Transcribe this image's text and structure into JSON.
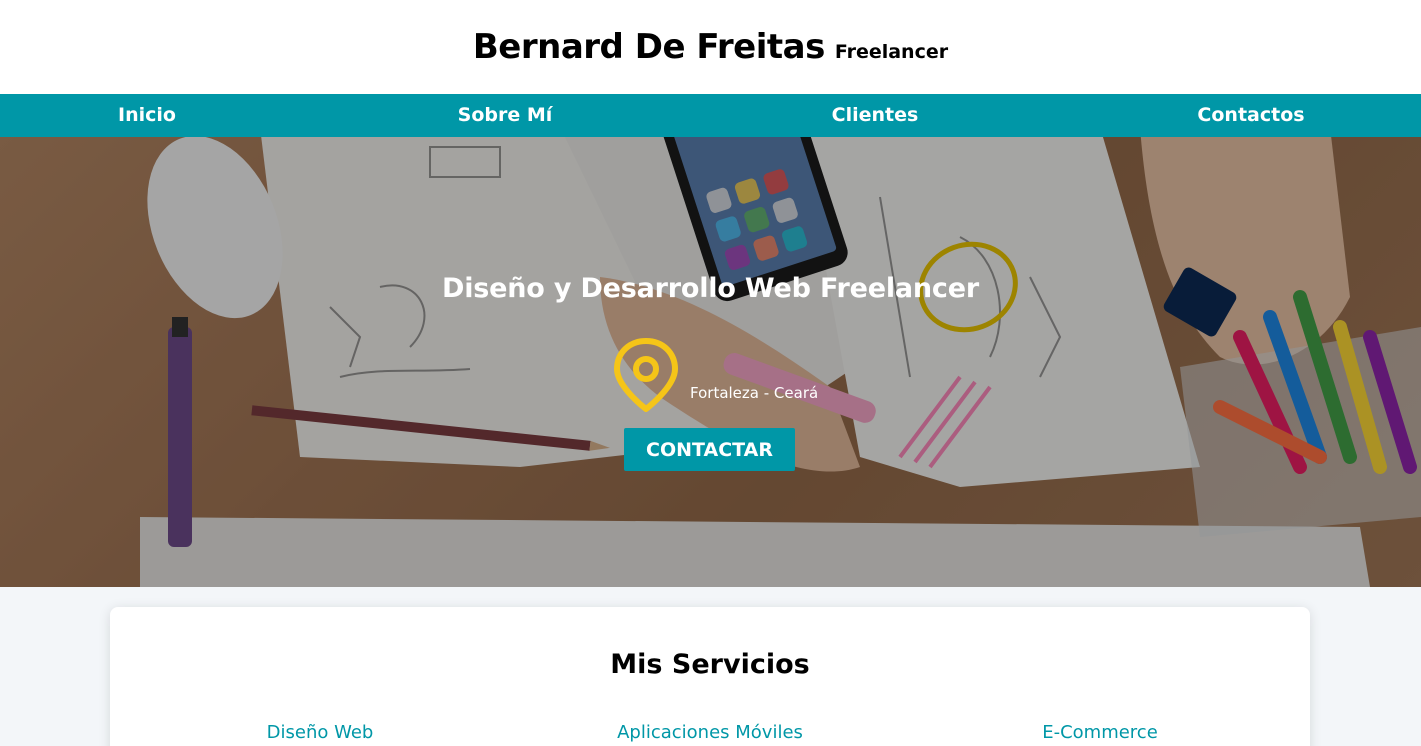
{
  "header": {
    "name": "Bernard De Freitas",
    "tagline": "Freelancer"
  },
  "nav": {
    "items": [
      {
        "label": "Inicio"
      },
      {
        "label": "Sobre Mí"
      },
      {
        "label": "Clientes"
      },
      {
        "label": "Contactos"
      }
    ]
  },
  "hero": {
    "title": "Diseño y Desarrollo Web Freelancer",
    "location": "Fortaleza - Ceará",
    "location_icon": "map-pin-icon",
    "cta_label": "CONTACTAR"
  },
  "services": {
    "title": "Mis Servicios",
    "items": [
      {
        "label": "Diseño Web"
      },
      {
        "label": "Aplicaciones Móviles"
      },
      {
        "label": "E-Commerce"
      }
    ]
  },
  "colors": {
    "accent": "#0097a7",
    "pin": "#f5c518",
    "header_bg": "#ffffff",
    "page_bg": "#f3f6f9"
  }
}
